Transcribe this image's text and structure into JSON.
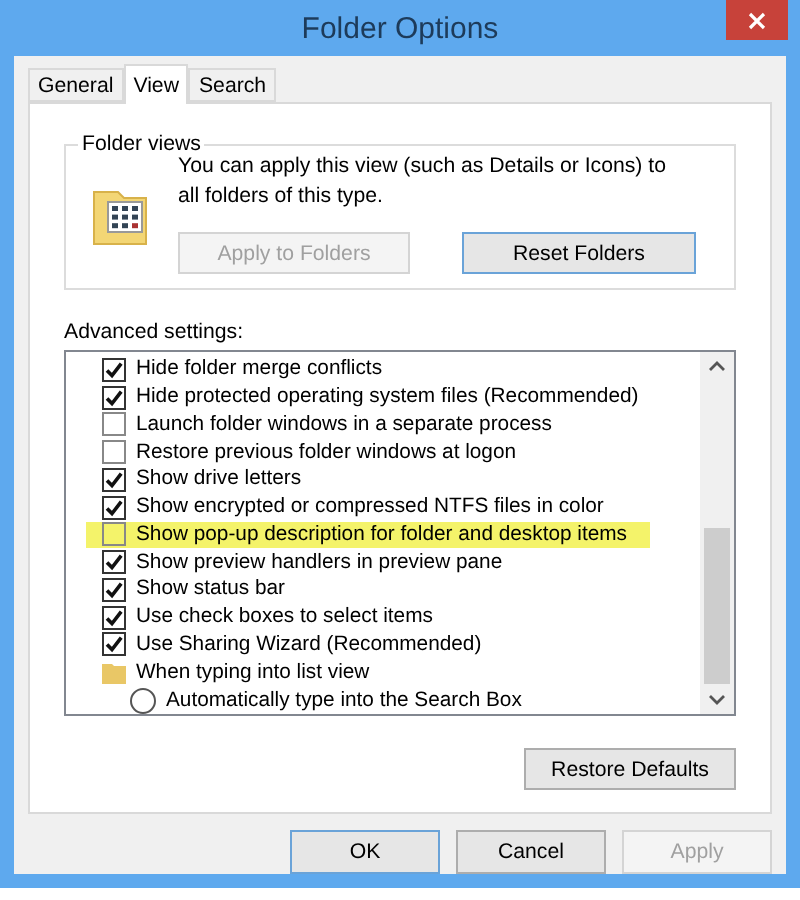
{
  "window": {
    "title": "Folder Options"
  },
  "tabs": [
    {
      "label": "General",
      "selected": false
    },
    {
      "label": "View",
      "selected": true
    },
    {
      "label": "Search",
      "selected": false
    }
  ],
  "folder_views": {
    "title": "Folder views",
    "description": "You can apply this view (such as Details or Icons) to all folders of this type.",
    "buttons": [
      {
        "label": "Apply to Folders",
        "disabled": true
      },
      {
        "label": "Reset Folders",
        "disabled": false
      }
    ]
  },
  "advanced": {
    "label": "Advanced settings:",
    "items": [
      {
        "kind": "check",
        "label": "Hide folder merge conflicts",
        "checked": true,
        "highlighted": false
      },
      {
        "kind": "check",
        "label": "Hide protected operating system files (Recommended)",
        "checked": true,
        "highlighted": false
      },
      {
        "kind": "check",
        "label": "Launch folder windows in a separate process",
        "checked": false,
        "highlighted": false
      },
      {
        "kind": "check",
        "label": "Restore previous folder windows at logon",
        "checked": false,
        "highlighted": false
      },
      {
        "kind": "check",
        "label": "Show drive letters",
        "checked": true,
        "highlighted": false
      },
      {
        "kind": "check",
        "label": "Show encrypted or compressed NTFS files in color",
        "checked": true,
        "highlighted": false
      },
      {
        "kind": "check",
        "label": "Show pop-up description for folder and desktop items",
        "checked": false,
        "highlighted": true
      },
      {
        "kind": "check",
        "label": "Show preview handlers in preview pane",
        "checked": true,
        "highlighted": false
      },
      {
        "kind": "check",
        "label": "Show status bar",
        "checked": true,
        "highlighted": false
      },
      {
        "kind": "check",
        "label": "Use check boxes to select items",
        "checked": true,
        "highlighted": false
      },
      {
        "kind": "check",
        "label": "Use Sharing Wizard (Recommended)",
        "checked": true,
        "highlighted": false
      },
      {
        "kind": "folder",
        "label": "When typing into list view"
      },
      {
        "kind": "radio",
        "label": "Automatically type into the Search Box",
        "selected": false
      }
    ]
  },
  "restore_button": "Restore Defaults",
  "buttons": [
    {
      "label": "OK",
      "disabled": false
    },
    {
      "label": "Cancel",
      "disabled": false
    },
    {
      "label": "Apply",
      "disabled": true
    }
  ]
}
